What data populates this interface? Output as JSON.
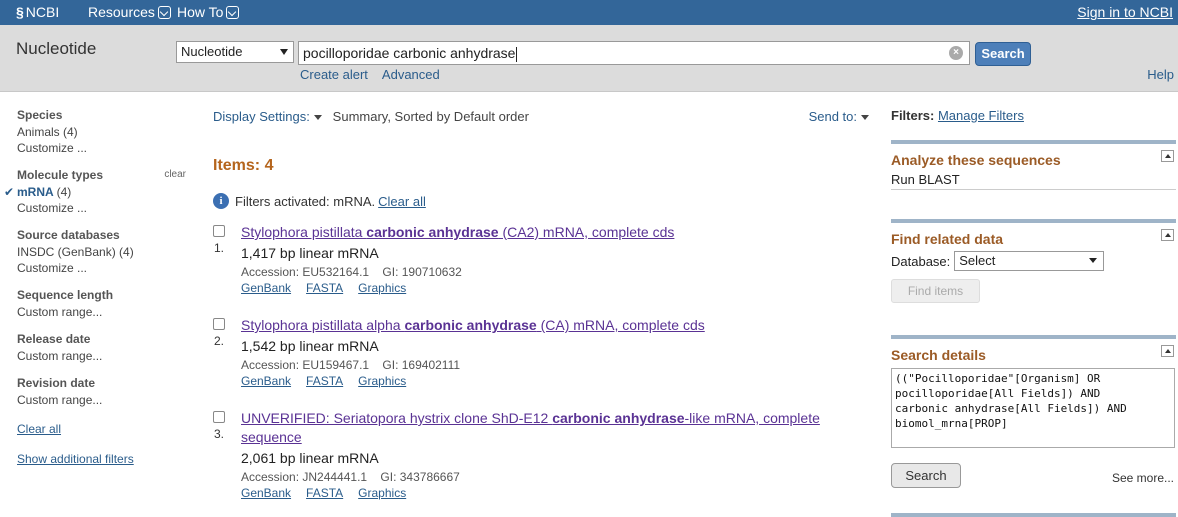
{
  "topbar": {
    "logo_text": "NCBI",
    "menus": [
      "Resources",
      "How To"
    ],
    "signin": "Sign in to NCBI"
  },
  "search": {
    "db_title": "Nucleotide",
    "db_selected": "Nucleotide",
    "term": "pocilloporidae carbonic anhydrase",
    "button": "Search",
    "create_alert": "Create alert",
    "advanced": "Advanced",
    "help": "Help"
  },
  "filters_left": {
    "species": {
      "heading": "Species",
      "items": [
        "Animals (4)",
        "Customize ..."
      ]
    },
    "molecule": {
      "heading": "Molecule types",
      "clear": "clear",
      "active_label": "mRNA",
      "active_count": "(4)",
      "customize": "Customize ..."
    },
    "source": {
      "heading": "Source databases",
      "items": [
        "INSDC (GenBank) (4)",
        "Customize ..."
      ]
    },
    "seqlen": {
      "heading": "Sequence length",
      "item": "Custom range..."
    },
    "release": {
      "heading": "Release date",
      "item": "Custom range..."
    },
    "revision": {
      "heading": "Revision date",
      "item": "Custom range..."
    },
    "clear_all": "Clear all",
    "show_additional": "Show additional filters"
  },
  "display": {
    "settings": "Display Settings:",
    "summary": "Summary, Sorted by Default order",
    "send_to": "Send to:"
  },
  "items_count": "Items: 4",
  "filter_note": {
    "text": "Filters activated: mRNA.",
    "clear_all": "Clear all"
  },
  "results": [
    {
      "num": "1.",
      "title_pre": "Stylophora pistillata ",
      "title_bold": "carbonic anhydrase",
      "title_post": " (CA2) mRNA, complete cds",
      "desc": "1,417 bp linear mRNA",
      "accession": "Accession: EU532164.1    GI: 190710632",
      "links": [
        "GenBank",
        "FASTA",
        "Graphics"
      ]
    },
    {
      "num": "2.",
      "title_pre": "Stylophora pistillata alpha ",
      "title_bold": "carbonic anhydrase",
      "title_post": " (CA) mRNA, complete cds",
      "desc": "1,542 bp linear mRNA",
      "accession": "Accession: EU159467.1    GI: 169402111",
      "links": [
        "GenBank",
        "FASTA",
        "Graphics"
      ]
    },
    {
      "num": "3.",
      "title_pre": "UNVERIFIED: Seriatopora hystrix clone ShD-E12 ",
      "title_bold": "carbonic anhydrase",
      "title_post": "-like mRNA, complete sequence",
      "desc": "2,061 bp linear mRNA",
      "accession": "Accession: JN244441.1    GI: 343786667",
      "links": [
        "GenBank",
        "FASTA",
        "Graphics"
      ]
    }
  ],
  "right": {
    "filters_label": "Filters:",
    "manage_filters": "Manage Filters",
    "analyze": {
      "heading": "Analyze these sequences",
      "link": "Run BLAST"
    },
    "related": {
      "heading": "Find related data",
      "db_label": "Database:",
      "db_selected": "Select",
      "find_items": "Find items"
    },
    "details": {
      "heading": "Search details",
      "query": "((\"Pocilloporidae\"[Organism] OR\npocilloporidae[All Fields]) AND\ncarbonic anhydrase[All Fields]) AND\nbiomol_mrna[PROP]",
      "search_button": "Search",
      "see_more": "See more..."
    }
  },
  "colors": {
    "topbar": "#336699",
    "header_bg": "#dcdcdc",
    "link": "#2a5c8b",
    "visited_title": "#5a3294",
    "portlet_heading": "#9b5b26",
    "items_count": "#b5651d"
  }
}
